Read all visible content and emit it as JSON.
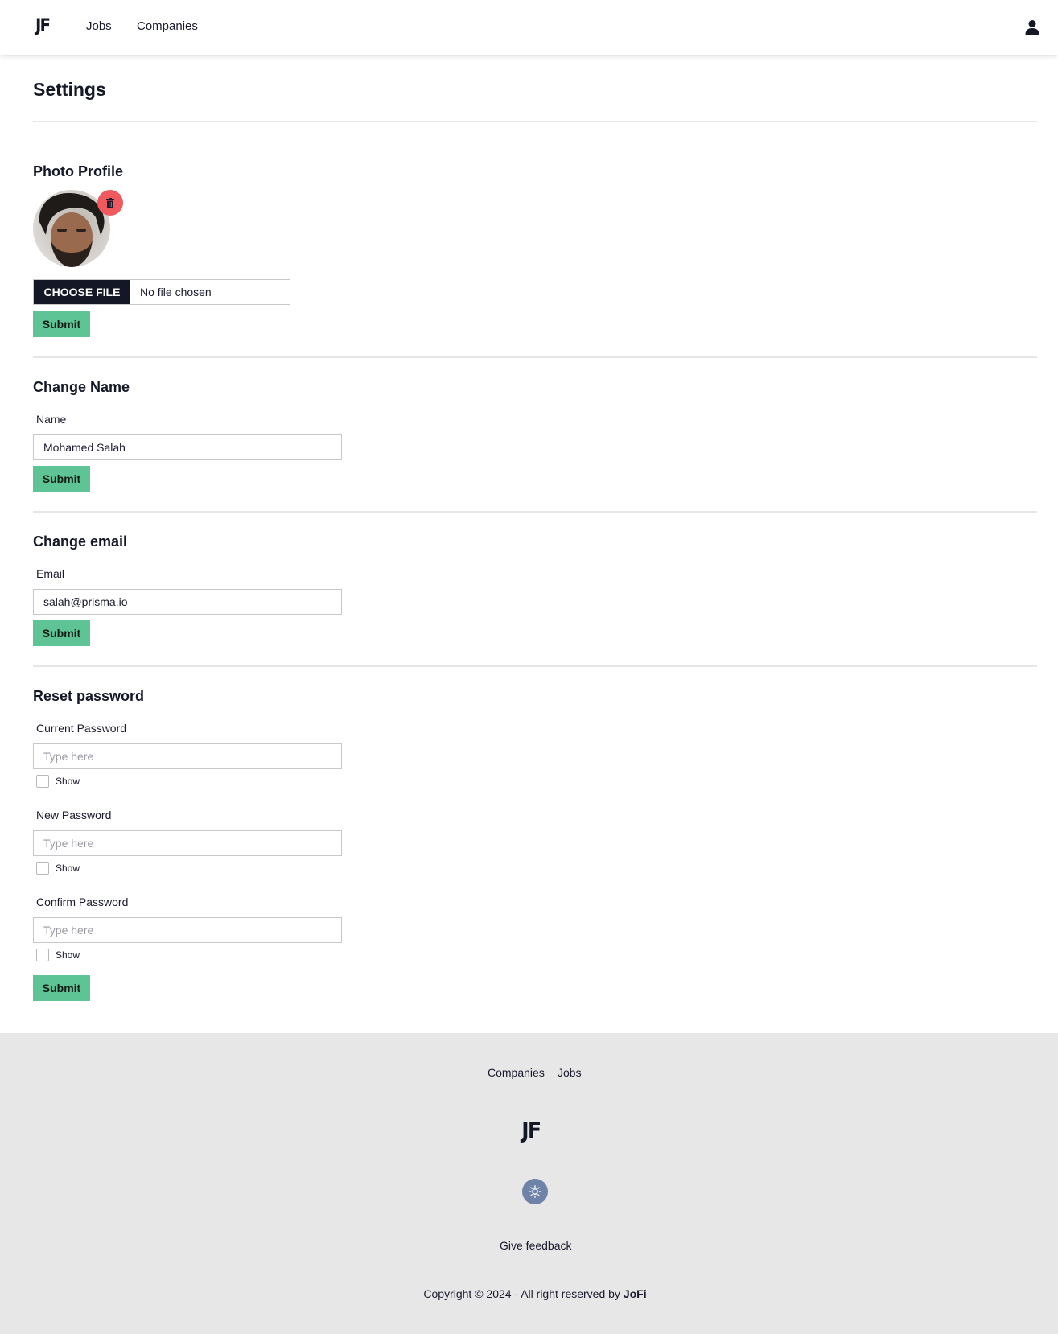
{
  "navbar": {
    "logo": "JF",
    "links": {
      "jobs": "Jobs",
      "companies": "Companies"
    },
    "user_icon": "user-icon"
  },
  "page": {
    "title": "Settings"
  },
  "photo_section": {
    "title": "Photo Profile",
    "delete_icon": "trash-icon",
    "file_button": "CHOOSE FILE",
    "file_status": "No file chosen",
    "submit": "Submit"
  },
  "name_section": {
    "title": "Change Name",
    "label": "Name",
    "value": "Mohamed Salah",
    "submit": "Submit"
  },
  "email_section": {
    "title": "Change email",
    "label": "Email",
    "value": "salah@prisma.io",
    "submit": "Submit"
  },
  "password_section": {
    "title": "Reset password",
    "current": {
      "label": "Current Password",
      "placeholder": "Type here",
      "show": "Show"
    },
    "new": {
      "label": "New Password",
      "placeholder": "Type here",
      "show": "Show"
    },
    "confirm": {
      "label": "Confirm Password",
      "placeholder": "Type here",
      "show": "Show"
    },
    "submit": "Submit"
  },
  "footer": {
    "links": {
      "companies": "Companies",
      "jobs": "Jobs"
    },
    "logo": "JF",
    "theme_icon": "sun-icon",
    "feedback": "Give feedback",
    "copyright_prefix": "Copyright © 2024 - All right reserved by ",
    "brand": "JoFi"
  },
  "colors": {
    "accent_green": "#5ec395",
    "dark": "#141726",
    "danger": "#f05a5f",
    "footer_bg": "#e7e7e8",
    "theme_toggle": "#6f82a8"
  }
}
